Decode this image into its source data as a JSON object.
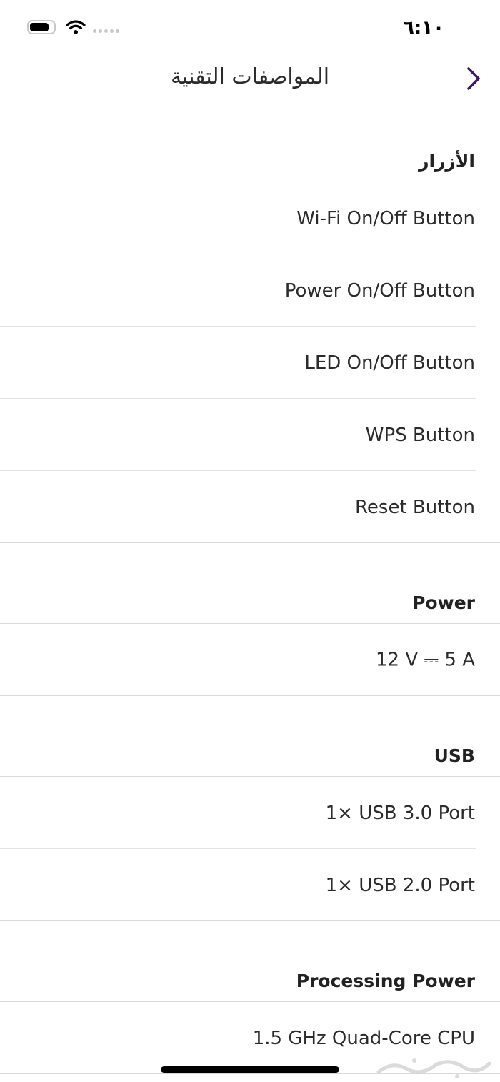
{
  "status_bar": {
    "time": "٦:١٠"
  },
  "header": {
    "title": "المواصفات التقنية"
  },
  "sections": [
    {
      "title": "الأزرار",
      "items": [
        "Wi-Fi On/Off Button",
        "Power On/Off Button",
        "LED On/Off Button",
        "WPS Button",
        "Reset Button"
      ]
    },
    {
      "title": "Power",
      "items": [
        "12 V ⎓ 5 A"
      ]
    },
    {
      "title": "USB",
      "items": [
        "1× USB 3.0 Port",
        "1× USB 2.0 Port"
      ]
    },
    {
      "title": "Processing Power",
      "items": [
        "1.5 GHz Quad-Core CPU"
      ]
    }
  ],
  "colors": {
    "accent": "#3d1a5b",
    "text": "#2b2b2b",
    "divider": "#e3e3e3"
  },
  "icons": {
    "back": "chevron-right-icon",
    "wifi": "wifi-icon",
    "battery": "battery-icon"
  }
}
